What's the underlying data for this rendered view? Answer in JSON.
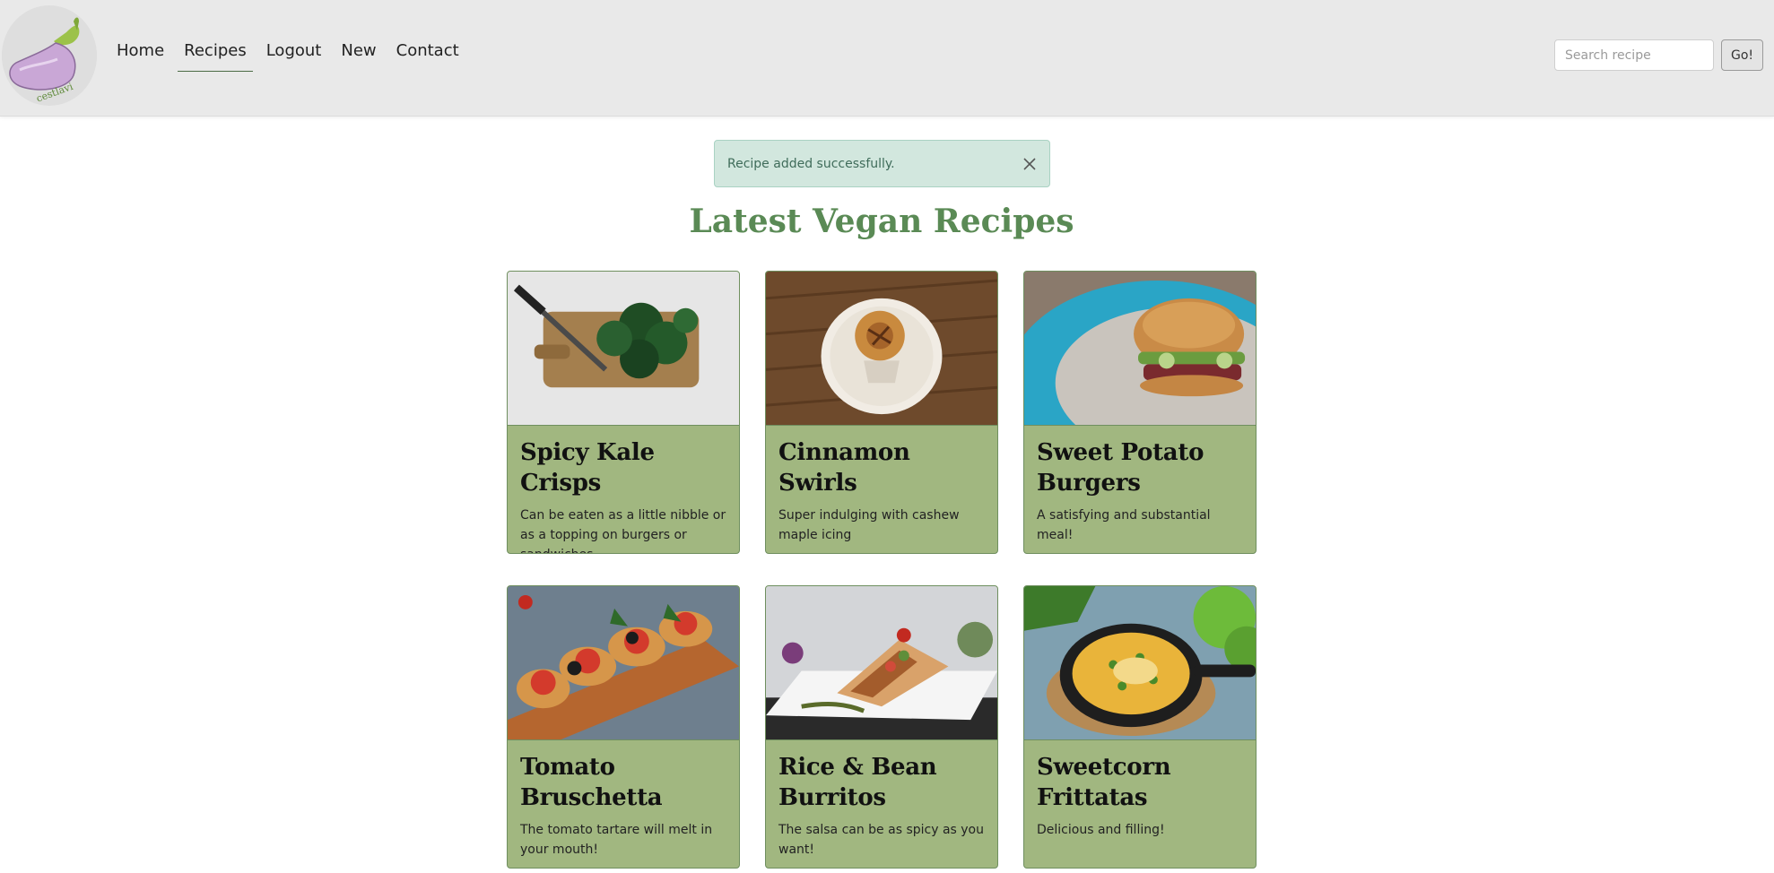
{
  "nav": {
    "logo_alt": "eggplant logo",
    "logo_text": "cestlavi",
    "links": [
      {
        "label": "Home"
      },
      {
        "label": "Recipes"
      },
      {
        "label": "Logout"
      },
      {
        "label": "New"
      },
      {
        "label": "Contact"
      }
    ],
    "active": "Recipes"
  },
  "search": {
    "placeholder": "Search recipe",
    "button_label": "Go!"
  },
  "alert": {
    "message": "Recipe added successfully."
  },
  "page_title": "Latest Vegan Recipes",
  "recipes": [
    {
      "title": "Spicy Kale Crisps",
      "description": "Can be eaten as a little nibble or as a topping on burgers or sandwiches",
      "image": "kale-photo"
    },
    {
      "title": "Cinnamon Swirls",
      "description": "Super indulging with cashew maple icing",
      "image": "cinnamon-swirl-photo"
    },
    {
      "title": "Sweet Potato Burgers",
      "description": "A satisfying and substantial meal!",
      "image": "burger-photo"
    },
    {
      "title": "Tomato Bruschetta",
      "description": "The tomato tartare will melt in your mouth!",
      "image": "bruschetta-photo"
    },
    {
      "title": "Rice & Bean Burritos",
      "description": "The salsa can be as spicy as you want!",
      "image": "burrito-photo"
    },
    {
      "title": "Sweetcorn Frittatas",
      "description": "Delicious and filling!",
      "image": "frittata-photo"
    }
  ],
  "colors": {
    "navbar_bg": "#e9e9e9",
    "title_green": "#5a8a55",
    "card_bg": "#a1b780",
    "alert_bg": "#d2e7de"
  }
}
